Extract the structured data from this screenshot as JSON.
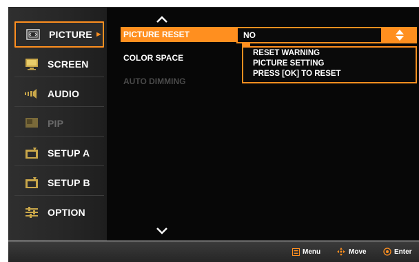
{
  "colors": {
    "accent": "#ff8f1f",
    "background": "#070707",
    "sidebar": "#2a2a2a",
    "disabled": "#4a4a4a"
  },
  "sidebar": {
    "items": [
      {
        "label": "PICTURE",
        "icon": "picture-icon",
        "active": true,
        "enabled": true,
        "arrow": "►"
      },
      {
        "label": "SCREEN",
        "icon": "screen-icon",
        "active": false,
        "enabled": true
      },
      {
        "label": "AUDIO",
        "icon": "audio-icon",
        "active": false,
        "enabled": true
      },
      {
        "label": "PIP",
        "icon": "pip-icon",
        "active": false,
        "enabled": false
      },
      {
        "label": "SETUP A",
        "icon": "setup-icon",
        "active": false,
        "enabled": true
      },
      {
        "label": "SETUP B",
        "icon": "setup-icon",
        "active": false,
        "enabled": true
      },
      {
        "label": "OPTION",
        "icon": "option-icon",
        "active": false,
        "enabled": true
      }
    ]
  },
  "menu": {
    "items": [
      {
        "label": "PICTURE RESET",
        "selected": true,
        "enabled": true
      },
      {
        "label": "COLOR SPACE",
        "selected": false,
        "enabled": true
      },
      {
        "label": "AUTO DIMMING",
        "selected": false,
        "enabled": false
      }
    ],
    "value": "NO"
  },
  "warning": {
    "lines": [
      "RESET WARNING",
      "PICTURE SETTING",
      "PRESS [OK] TO RESET"
    ]
  },
  "footer": {
    "hints": [
      {
        "label": "Menu",
        "icon": "menu-icon"
      },
      {
        "label": "Move",
        "icon": "move-icon"
      },
      {
        "label": "Enter",
        "icon": "enter-icon"
      }
    ]
  }
}
